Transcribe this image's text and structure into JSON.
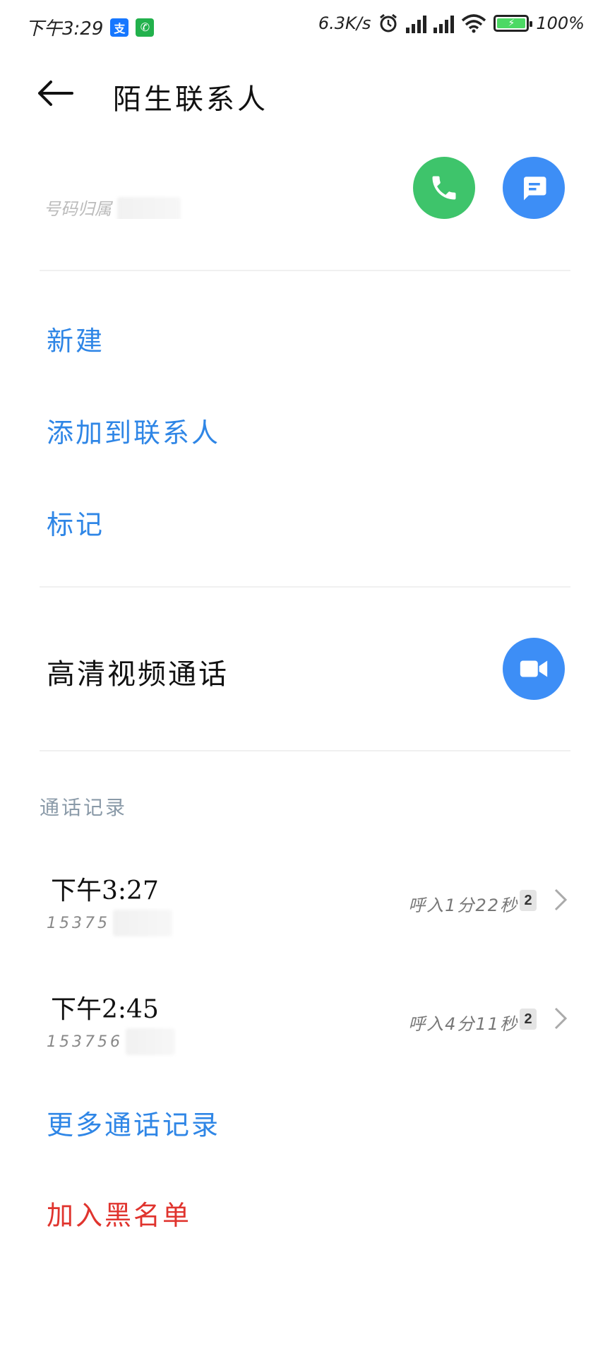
{
  "status_bar": {
    "time": "下午3:29",
    "app_icons": [
      {
        "name": "alipay-icon",
        "glyph": "支",
        "color": "#1677ff"
      },
      {
        "name": "phone-notification-icon",
        "glyph": "✆",
        "color": "#22b14c"
      }
    ],
    "net_speed": "6.3K/s",
    "battery": "100%"
  },
  "header": {
    "title": "陌生联系人"
  },
  "contact": {
    "number_partial": "号码归属"
  },
  "actions": {
    "new": "新建",
    "add_to_contacts": "添加到联系人",
    "mark": "标记"
  },
  "video_call": {
    "label": "高清视频通话"
  },
  "call_log": {
    "section_title": "通话记录",
    "entries": [
      {
        "time": "下午3:27",
        "number_prefix": "15375",
        "info": "呼入1分22秒",
        "sim": "2"
      },
      {
        "time": "下午2:45",
        "number_prefix": "153756",
        "info": "呼入4分11秒",
        "sim": "2"
      }
    ],
    "more": "更多通话记录"
  },
  "blacklist": "加入黑名单",
  "colors": {
    "accent_blue": "#2f86e6",
    "call_green": "#3ec46b",
    "button_blue": "#3d8ef6",
    "danger_red": "#e0342e"
  }
}
